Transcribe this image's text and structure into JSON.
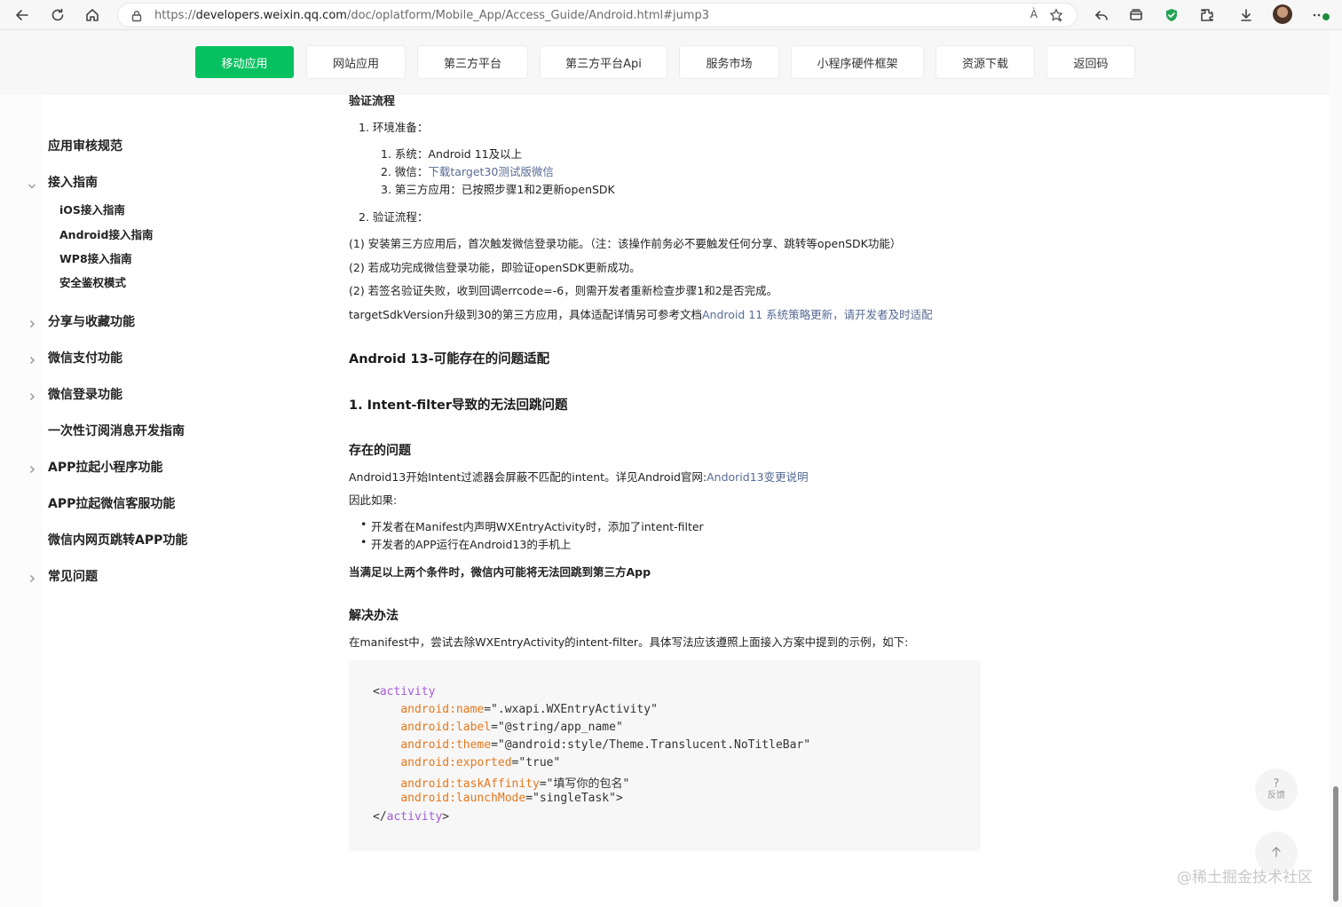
{
  "browser": {
    "url_prefix": "https://",
    "url_host": "developers.weixin.qq.com",
    "url_path": "/doc/oplatform/Mobile_App/Access_Guide/Android.html#jump3",
    "read_aloud_label": "À"
  },
  "topnav": {
    "items": [
      "移动应用",
      "网站应用",
      "第三方平台",
      "第三方平台Api",
      "服务市场",
      "小程序硬件框架",
      "资源下载",
      "返回码"
    ],
    "active_color": "#07c160"
  },
  "sidebar": {
    "items": [
      {
        "label": "应用审核规范"
      },
      {
        "label": "接入指南",
        "expanded": true,
        "children": [
          "iOS接入指南",
          "Android接入指南",
          "WP8接入指南",
          "安全鉴权模式"
        ]
      },
      {
        "label": "分享与收藏功能"
      },
      {
        "label": "微信支付功能"
      },
      {
        "label": "微信登录功能"
      },
      {
        "label": "一次性订阅消息开发指南"
      },
      {
        "label": "APP拉起小程序功能"
      },
      {
        "label": "APP拉起微信客服功能"
      },
      {
        "label": "微信内网页跳转APP功能"
      },
      {
        "label": "常见问题"
      }
    ]
  },
  "content": {
    "partial_heading": "验证流程",
    "step1": "1. 环境准备：",
    "env_items": {
      "sys": "1. 系统：Android 11及以上",
      "wx_prefix": "2. 微信：",
      "wx_link": "下载target30测试版微信",
      "app": "3. 第三方应用：已按照步骤1和2更新openSDK"
    },
    "step2": "2. 验证流程：",
    "para1": "(1) 安装第三方应用后，首次触发微信登录功能。（注：该操作前务必不要触发任何分享、跳转等openSDK功能）",
    "para2": "(2) 若成功完成微信登录功能，即验证openSDK更新成功。",
    "para3": "(2) 若签名验证失败，收到回调errcode=-6，则需开发者重新检查步骤1和2是否完成。",
    "para4_prefix": "targetSdkVersion升级到30的第三方应用，具体适配详情另可参考文档",
    "para4_link": "Android 11 系统策略更新，请开发者及时适配",
    "h_android13": "Android 13-可能存在的问题适配",
    "h_intent": "1. Intent-filter导致的无法回跳问题",
    "h_problem": "存在的问题",
    "problem_prefix": "Android13开始Intent过滤器会屏蔽不匹配的intent。详见Android官网:",
    "problem_link": "Andorid13变更说明",
    "therefore": "因此如果:",
    "bullet1": "开发者在Manifest内声明WXEntryActivity时，添加了intent-filter",
    "bullet2": "开发者的APP运行在Android13的手机上",
    "conclusion": "当满足以上两个条件时，微信内可能将无法回跳到第三方App",
    "h_solution": "解决办法",
    "solution": "在manifest中，尝试去除WXEntryActivity的intent-filter。具体写法应该遵照上面接入方案中提到的示例，如下:"
  },
  "code": {
    "open_lt": "<",
    "tag": "activity",
    "close_lt": "</",
    "gt": ">",
    "lines": [
      {
        "attr": "android:name",
        "value": "=\".wxapi.WXEntryActivity\""
      },
      {
        "attr": "android:label",
        "value": "=\"@string/app_name\""
      },
      {
        "attr": "android:theme",
        "value": "=\"@android:style/Theme.Translucent.NoTitleBar\""
      },
      {
        "attr": "android:exported",
        "value": "=\"true\""
      },
      {
        "attr": "android:taskAffinity",
        "value": "=\"填写你的包名\""
      },
      {
        "attr": "android:launchMode",
        "value": "=\"singleTask\">"
      }
    ]
  },
  "feedback": {
    "icon_text": "?",
    "label": "反馈"
  },
  "watermark": "@稀土掘金技术社区"
}
